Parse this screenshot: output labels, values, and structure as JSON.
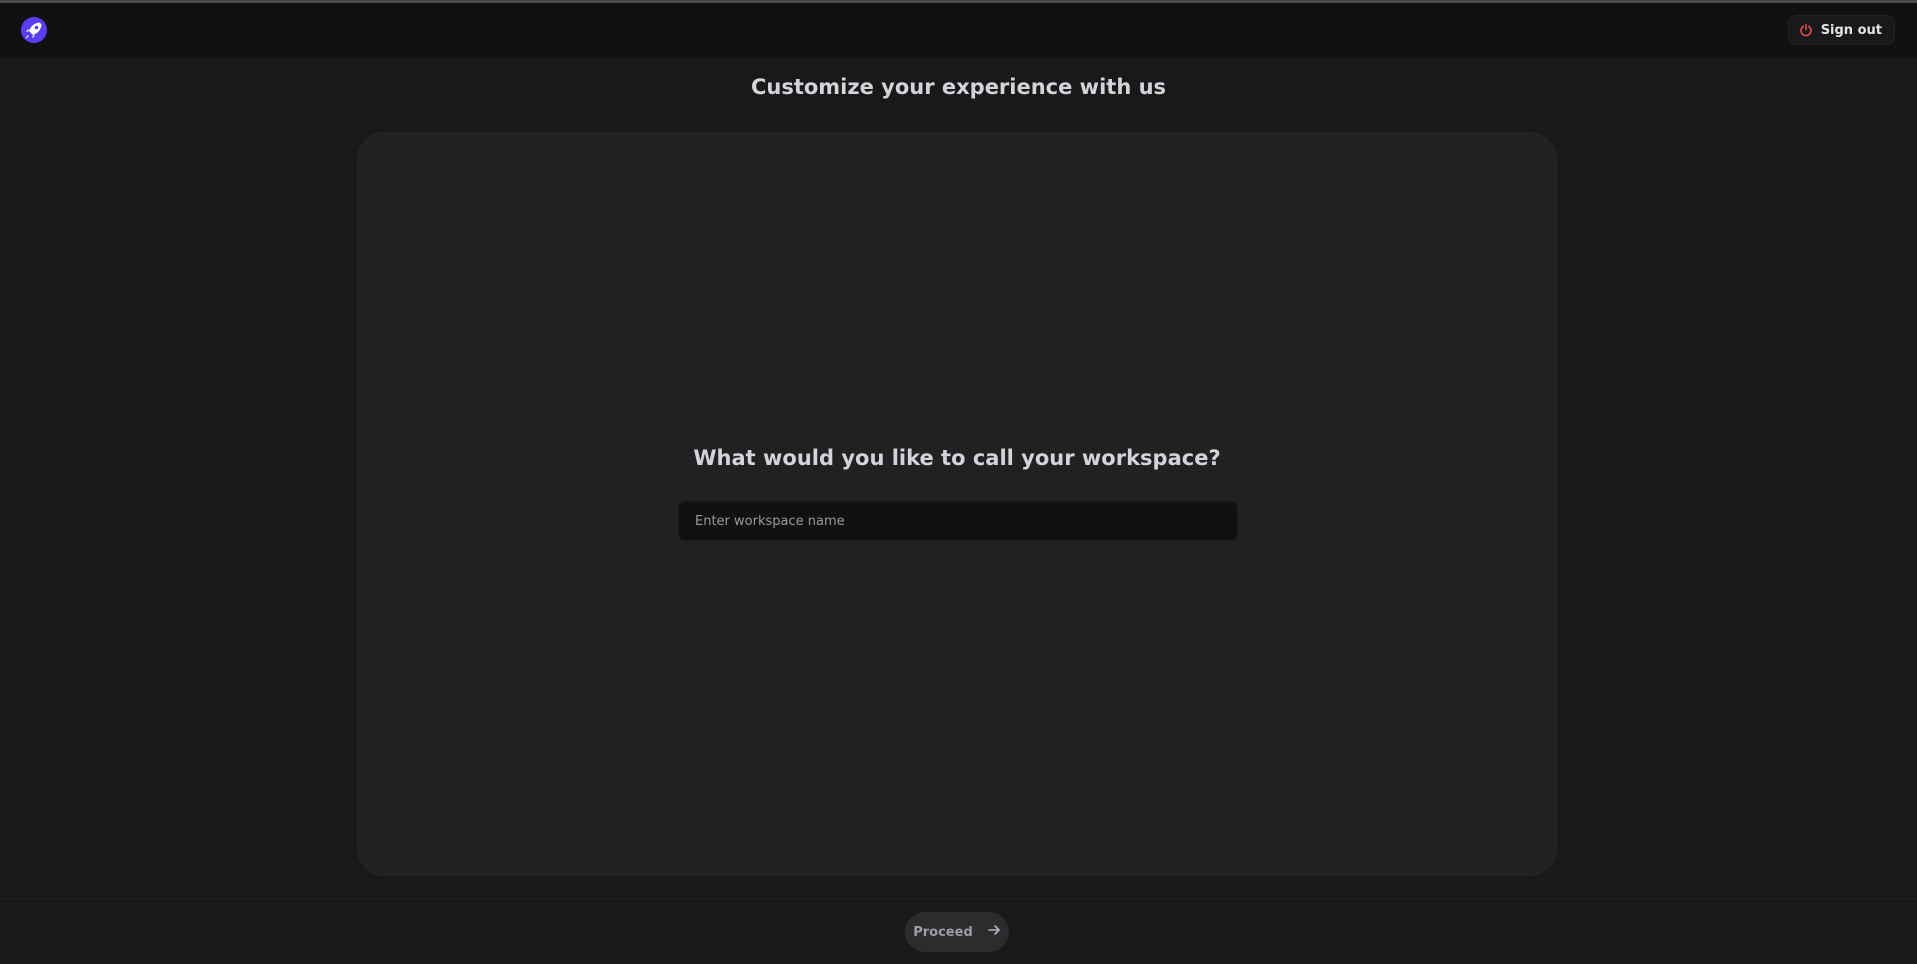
{
  "header": {
    "logo_icon": "rocket-icon",
    "signout_icon": "power-icon",
    "signout_label": "Sign out",
    "signout_icon_color": "#e5484d"
  },
  "page": {
    "title": "Customize your experience with us"
  },
  "workspace": {
    "question": "What would you like to call your workspace?",
    "input_value": "",
    "input_placeholder": "Enter workspace name"
  },
  "footer": {
    "proceed_label": "Proceed",
    "proceed_icon": "arrow-right-icon"
  },
  "colors": {
    "background": "#19191b",
    "header": "#111112",
    "card": "#212124",
    "accent": "#5b3df5"
  }
}
